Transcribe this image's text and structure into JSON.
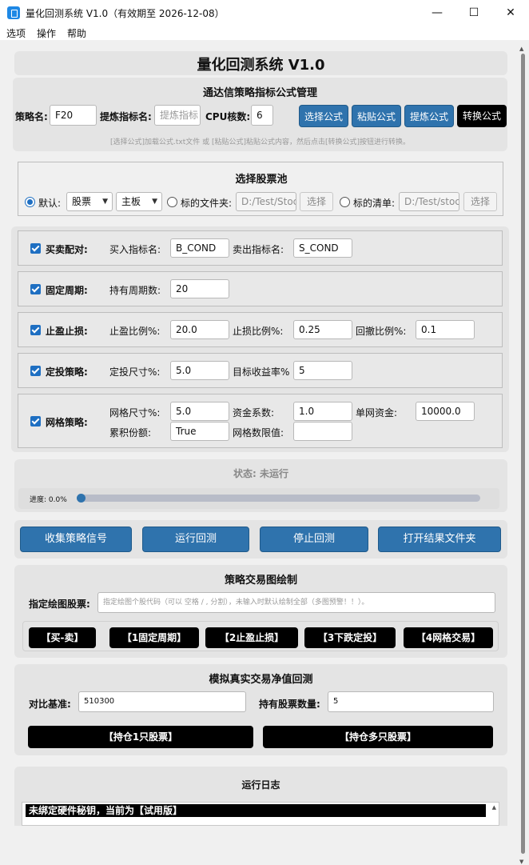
{
  "window": {
    "title": "量化回测系统 V1.0（有效期至 2026-12-08）",
    "minimize": "—",
    "maximize": "☐",
    "close": "✕"
  },
  "menu": [
    "选项",
    "操作",
    "帮助"
  ],
  "header": {
    "title": "量化回测系统 V1.0"
  },
  "formula": {
    "section_title": "通达信策略指标公式管理",
    "strategy_label": "策略名:",
    "strategy_value": "F20",
    "indicator_label": "提炼指标名:",
    "indicator_placeholder": "提炼指标",
    "cpu_label": "CPU核数:",
    "cpu_value": "6",
    "buttons": [
      "选择公式",
      "粘贴公式",
      "提炼公式",
      "转换公式"
    ],
    "hint": "[选择公式]加载公式.txt文件 或 [粘贴公式]粘贴公式内容，然后点击[转换公式]按钮进行转换。"
  },
  "pool": {
    "title": "选择股票池",
    "default_label": "默认:",
    "type_value": "股票",
    "board_value": "主板",
    "folder_label": "标的文件夹:",
    "folder_value": "D:/Test/Stoc",
    "folder_btn": "选择",
    "list_label": "标的清单:",
    "list_value": "D:/Test/stoc",
    "list_btn": "选择"
  },
  "strategies": {
    "pair": {
      "label": "买卖配对:",
      "buy_label": "买入指标名:",
      "buy_value": "B_COND",
      "sell_label": "卖出指标名:",
      "sell_value": "S_COND"
    },
    "fixed": {
      "label": "固定周期:",
      "hold_label": "持有周期数:",
      "hold_value": "20"
    },
    "stop": {
      "label": "止盈止损:",
      "tp_label": "止盈比例%:",
      "tp_value": "20.0",
      "sl_label": "止损比例%:",
      "sl_value": "0.25",
      "dd_label": "回撤比例%:",
      "dd_value": "0.1"
    },
    "dca": {
      "label": "定投策略:",
      "size_label": "定投尺寸%:",
      "size_value": "5.0",
      "target_label": "目标收益率%",
      "target_value": "5"
    },
    "grid": {
      "label": "网格策略:",
      "size_label": "网格尺寸%:",
      "size_value": "5.0",
      "coef_label": "资金系数:",
      "coef_value": "1.0",
      "single_label": "单网资金:",
      "single_value": "10000.0",
      "acc_label": "累积份额:",
      "acc_value": "True",
      "limit_label": "网格数限值:",
      "limit_value": ""
    }
  },
  "status": {
    "text": "状态: 未运行",
    "progress_label": "进度: 0.0%",
    "progress": 0.0
  },
  "actions": [
    "收集策略信号",
    "运行回测",
    "停止回测",
    "打开结果文件夹"
  ],
  "plot": {
    "title": "策略交易图绘制",
    "stock_label": "指定绘图股票:",
    "stock_placeholder": "指定绘图个股代码（可以 空格 / , 分割），未输入时默认绘制全部（多图预警！！）。",
    "buttons": [
      "【买-卖】",
      "【1固定周期】",
      "【2止盈止损】",
      "【3下跌定投】",
      "【4网格交易】"
    ]
  },
  "sim": {
    "title": "模拟真实交易净值回测",
    "bench_label": "对比基准:",
    "bench_value": "510300",
    "count_label": "持有股票数量:",
    "count_value": "5",
    "btn_single": "【持仓1只股票】",
    "btn_multi": "【持仓多只股票】"
  },
  "log": {
    "title": "运行日志",
    "line": "未绑定硬件秘钥，当前为【试用版】"
  },
  "colors": {
    "accent": "#2f73ad",
    "checkbox": "#1e6fc2",
    "progress_track": "#b8bcc8"
  }
}
